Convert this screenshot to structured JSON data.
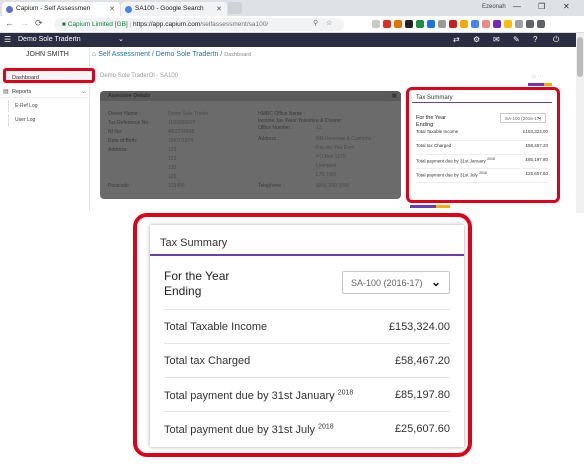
{
  "browser": {
    "tabs": [
      {
        "title": "Capium - Self Assessmen",
        "active": true
      },
      {
        "title": "SA100 - Google Search",
        "active": false
      }
    ],
    "url_secure_label": "Capium Limited [GB]",
    "url_host": "https://app.capium.com",
    "url_path": "/selfassessment/sa100/",
    "window_user": "Ezeonah",
    "controls": {
      "minimize": "—",
      "maximize": "❐",
      "close": "✕"
    }
  },
  "app": {
    "title": "Demo Sole Tradertn",
    "colors": {
      "header_bg": "#2b2d42",
      "accent": "#6a3db1",
      "highlight": "#e0001a",
      "link": "#1a73b8"
    }
  },
  "sidebar": {
    "user_name": "JOHN SMITH",
    "items": [
      {
        "label": "Dashboard",
        "icon": "home-icon"
      },
      {
        "label": "Reports",
        "icon": "file-icon"
      }
    ],
    "sub_items": [
      {
        "label": "E-Ref Log"
      },
      {
        "label": "User Log"
      }
    ]
  },
  "breadcrumb": {
    "items": [
      "Self Assessment",
      "Demo Sole Tradertn"
    ],
    "current": "Dashboard"
  },
  "page_heading": "Demo Sole TraderOl - SA100",
  "assessee": {
    "title": "Assessee Details",
    "left": [
      {
        "label": "Owner Name :",
        "value": "Demo Sole Trader"
      },
      {
        "label": "Tax Reference No :",
        "value": "1183050227"
      },
      {
        "label": "NI No:",
        "value": "AB123456B"
      },
      {
        "label": "Date of Birth:",
        "value": "16/07/1974"
      },
      {
        "label": "Address:",
        "value": "123"
      },
      {
        "label": "",
        "value": "123"
      },
      {
        "label": "",
        "value": "123"
      },
      {
        "label": "",
        "value": "123"
      },
      {
        "label": "Postcode :",
        "value": "123456"
      }
    ],
    "right": [
      {
        "label": "HMRC Office Name :",
        "value": ""
      },
      {
        "label": "Income Tax Wear Yorkshire & Clearer",
        "value": ""
      },
      {
        "label": "Office Number :",
        "value": "13"
      },
      {
        "label": "Address :",
        "value": "HM Revenue & Customs"
      },
      {
        "label": "",
        "value": "Pay-As-You Earn"
      },
      {
        "label": "",
        "value": "PO Box 1970"
      },
      {
        "label": "",
        "value": "Liverpool"
      },
      {
        "label": "",
        "value": "L75 1WX"
      },
      {
        "label": "Telephone :",
        "value": "0300 200 3300"
      }
    ]
  },
  "tax_summary": {
    "title": "Tax Summary",
    "year_label": "For the Year Ending",
    "year_label_line1": "For the Year",
    "year_label_line2": "Ending",
    "selected_year": "SA-100 (2016-17)",
    "selected_year_small": "SA-100 (2016-17)",
    "rows": [
      {
        "label": "Total Taxable Income",
        "sup": "",
        "value": "£153,324.00"
      },
      {
        "label": "Total tax Charged",
        "sup": "",
        "value": "£58,467.20"
      },
      {
        "label": "Total payment due by 31st January",
        "sup": "2018",
        "value": "£85,197.80"
      },
      {
        "label": "Total payment due by 31st July",
        "sup": "2018",
        "value": "£25,607.60"
      }
    ]
  }
}
